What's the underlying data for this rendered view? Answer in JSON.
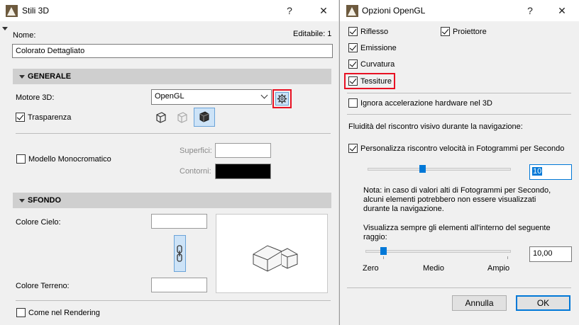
{
  "left_window": {
    "title": "Stili 3D",
    "help": "?",
    "close": "✕",
    "name_label": "Nome:",
    "editable_label": "Editabile: 1",
    "name_value": "Colorato Dettagliato",
    "general_section": "GENERALE",
    "engine_label": "Motore 3D:",
    "engine_value": "OpenGL",
    "transparency_label": "Trasparenza",
    "transparency_checked": true,
    "mono_label": "Modello Monocromatico",
    "mono_checked": false,
    "surfaces_label": "Superfici:",
    "contours_label": "Contorni:",
    "background_section": "SFONDO",
    "sky_color_label": "Colore Cielo:",
    "ground_color_label": "Colore Terreno:",
    "as_rendering_label": "Come nel Rendering",
    "as_rendering_checked": false,
    "colors": {
      "contour_swatch": "#000000",
      "sky_swatch": "#ffffff",
      "ground_swatch": "#ffffff",
      "accent": "#0078d7",
      "highlight_red": "#e81123"
    }
  },
  "right_window": {
    "title": "Opzioni OpenGL",
    "help": "?",
    "close": "✕",
    "reflection_label": "Riflesso",
    "projector_label": "Proiettore",
    "emission_label": "Emissione",
    "curvature_label": "Curvatura",
    "textures_label": "Tessiture",
    "ignore_hw_label": "Ignora accelerazione hardware nel 3D",
    "fluidity_label": "Fluidità del riscontro visivo durante la navigazione:",
    "custom_fps_label": "Personalizza riscontro velocità in Fotogrammi per Secondo",
    "fps_value": "10",
    "fps_slider_fraction": 0.37,
    "note_text_1": "Nota: in caso di valori alti di Fotogrammi per Secondo,",
    "note_text_2": "alcuni elementi potrebbero non essere visualizzati",
    "note_text_3": "durante la navigazione.",
    "range_text_1": "Visualizza sempre gli elementi all'interno del seguente",
    "range_text_2": "raggio:",
    "range_value": "10,00",
    "range_slider_fraction": 0.1,
    "scale_zero": "Zero",
    "scale_medium": "Medio",
    "scale_max": "Ampio",
    "cancel_label": "Annulla",
    "ok_label": "OK"
  }
}
